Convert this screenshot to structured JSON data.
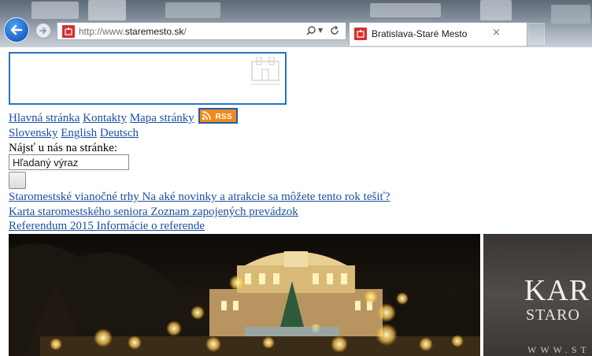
{
  "browser": {
    "address": {
      "prefix": "http://www.",
      "domain": "staremesto.sk",
      "suffix": "/"
    },
    "tab_title": "Bratislava-Staré Mesto",
    "tab_close": "×",
    "icons": [
      "back-arrow-icon",
      "forward-arrow-icon",
      "site-favicon-icon",
      "search-icon",
      "chevron-down-icon",
      "refresh-icon",
      "close-icon"
    ]
  },
  "site": {
    "nav": [
      "Hlavná stránka",
      "Kontakty",
      "Mapa stránky"
    ],
    "rss_label": "RSS",
    "languages": [
      "Slovensky",
      "English",
      "Deutsch"
    ],
    "search_label": "Nájsť u nás na stránke:",
    "search_value": "Hľadaný výraz",
    "news": [
      "Staromestské vianočné trhy Na aké novinky a atrakcie sa môžete tento rok tešiť?",
      "Karta staromestského seniora Zoznam zapojených prevádzok",
      "Referendum 2015 Informácie o referende"
    ],
    "side_banner": {
      "title": "KAR",
      "subtitle": "STARO",
      "url": "WWW.ST"
    }
  },
  "colors": {
    "link": "#1a4fa3",
    "accent_border": "#2a72c0",
    "rss_orange": "#f08a1c",
    "favicon_red": "#d42f2f"
  }
}
